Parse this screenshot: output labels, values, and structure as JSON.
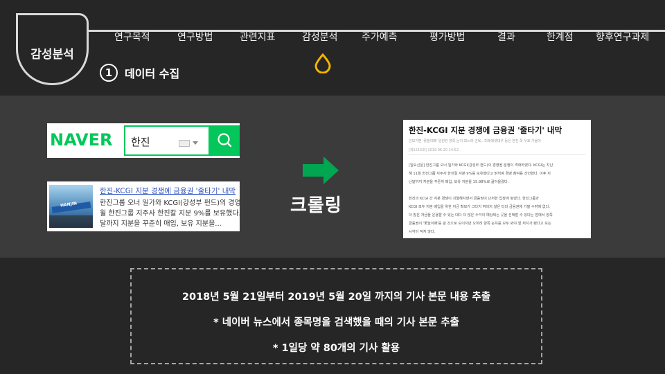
{
  "section": {
    "label": "감성분석"
  },
  "nav": {
    "items": [
      {
        "label": "연구목적"
      },
      {
        "label": "연구방법"
      },
      {
        "label": "관련지표"
      },
      {
        "label": "감성분석"
      },
      {
        "label": "주가예측"
      },
      {
        "label": "평가방법"
      },
      {
        "label": "결과"
      },
      {
        "label": "한계점"
      },
      {
        "label": "향후연구과제"
      }
    ],
    "active_index": 3,
    "marker_color": "#f4b400"
  },
  "step": {
    "number": "1",
    "title": "데이터 수집"
  },
  "naver": {
    "logo": "NAVER",
    "query": "한진",
    "brand_color": "#03c75a"
  },
  "news_result": {
    "title": "한진-KCGI 지분 경쟁에 금융권 '줄타기' 내막",
    "snippet": [
      "한진그룹 오너 일가와 KCGI(강성부 펀드)의 경영권",
      "월 한진그룹 지주사 한진칼 지분 9%를 보유했다고",
      "달까지 지분을 꾸준히 매입, 보유 지분을..."
    ],
    "thumb_text": "HANJIN"
  },
  "crawl": {
    "label": "크롤링",
    "arrow_color": "#00a650"
  },
  "article": {
    "title": "한진-KCGI 지분 경쟁에 금융권 '줄타기' 내막",
    "subtitle": "곤보기맨 '꽃놀이패' 임원한 양쪽 눈치 보느라 곤욕…미래에셋대우 등은 한진 쪽 우호 기울어",
    "date": "[제1515호] 2019.06.20 14:52",
    "lines": [
      "[일요신문] 한진그룹 오너 일가와 KCGI(강성부 펀드)의 경영권 분쟁이 격화하였다. KCGI는 지난",
      "해 11월 한진그룹 지주사 한진칼 지분 9%를 보유했다고 밝히며 경영 참여를 선언했다. 이후 지",
      "난달까지 지분을 꾸준히 매입, 보유 지분을 15.98%로 끌어올렸다.",
      "",
      "한진과 KCGI 간 지분 경쟁이 치열해지면서 금융권이 난처한 입장에 놓였다. 한진그룹과",
      "KCGI 모두 지분 매입을 위한 자금 확보가 그다지 여의치 않은 터라 금융권에 기댈 수밖에 없다.",
      "더 많은 자금을 운용할 수 있는 대다 더 많은 수익이 예상되는 곳을 선택할 수 있다는 점에서 양쪽",
      "금융권이 '꽃놀이패'를 쥔 것으로 보이지만 오히려 양쪽 눈치를 모두 봐야 할 처지가 됐다고 보는",
      "시각이 적지 않다."
    ]
  },
  "summary": {
    "lines": [
      "2018년 5월 21일부터 2019년 5월 20일 까지의 기사 본문 내용 추출",
      "* 네이버 뉴스에서 종목명을 검색했을 때의 기사 본문 추출",
      "* 1일당 약 80개의 기사 활용"
    ]
  }
}
